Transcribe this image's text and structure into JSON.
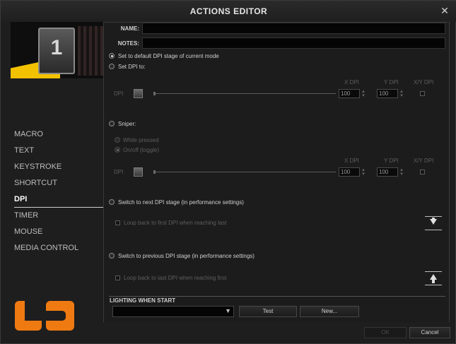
{
  "window": {
    "title": "ACTIONS EDITOR",
    "close_glyph": "✕"
  },
  "device": {
    "profile_number": "1"
  },
  "sidebar": {
    "items": [
      {
        "label": "MACRO",
        "active": false
      },
      {
        "label": "TEXT",
        "active": false
      },
      {
        "label": "KEYSTROKE",
        "active": false
      },
      {
        "label": "SHORTCUT",
        "active": false
      },
      {
        "label": "DPI",
        "active": true
      },
      {
        "label": "TIMER",
        "active": false
      },
      {
        "label": "MOUSE",
        "active": false
      },
      {
        "label": "MEDIA CONTROL",
        "active": false
      }
    ]
  },
  "form": {
    "name_label": "NAME:",
    "name_value": "",
    "notes_label": "NOTES:",
    "notes_value": ""
  },
  "dpi": {
    "default_option": "Set to default DPI stage of current mode",
    "set_option": "Set DPI to:",
    "sniper_option": "Sniper:",
    "while_pressed": "While pressed",
    "on_off": "On/off (toggle)",
    "next_stage": "Switch to next DPI stage (in performance settings)",
    "loop_first": "Loop back to first DPI when reaching last",
    "prev_stage": "Switch to previous DPI stage (in performance settings)",
    "loop_last": "Loop back to last DPI when reaching first",
    "col_x": "X DPI",
    "col_y": "Y DPI",
    "col_xy": "X/Y DPI",
    "dpi_label": "DPI",
    "set_x": "100",
    "set_y": "100",
    "sniper_x": "100",
    "sniper_y": "100"
  },
  "lighting": {
    "title": "LIGHTING WHEN START",
    "selected": "",
    "test_label": "Test",
    "new_label": "New..."
  },
  "footer": {
    "ok_label": "OK",
    "cancel_label": "Cancel"
  }
}
